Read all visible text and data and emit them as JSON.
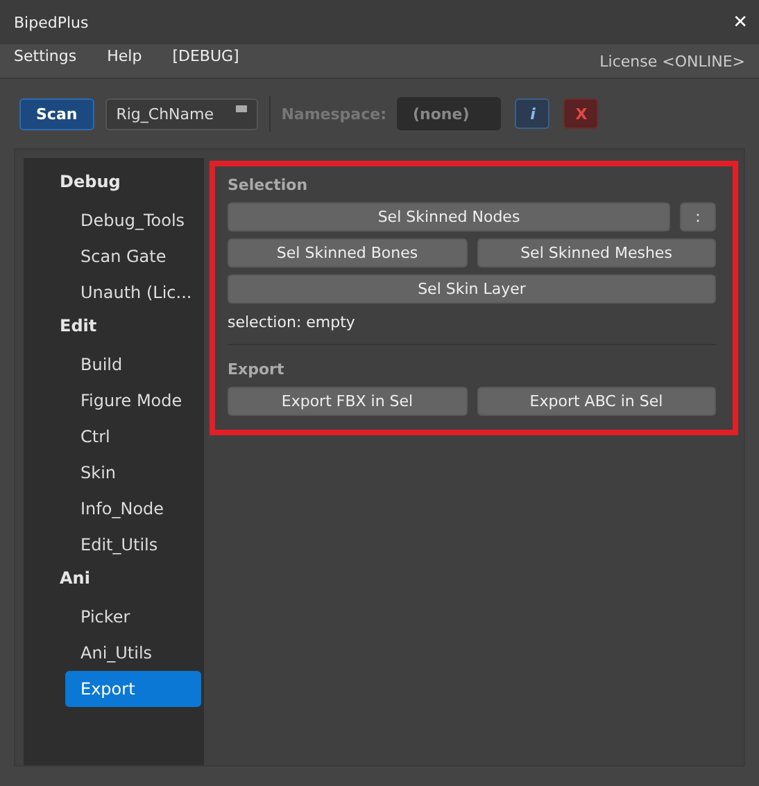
{
  "window": {
    "title": "BipedPlus",
    "close": "✕"
  },
  "menu": [
    "Settings",
    "Help",
    "[DEBUG]"
  ],
  "license": "License <ONLINE>",
  "toolbar": {
    "scan": "Scan",
    "rig_name": "Rig_ChName",
    "namespace_label": "Namespace:",
    "namespace_value": "(none)",
    "info": "i",
    "clear": "X"
  },
  "sidebar": {
    "groups": [
      {
        "label": "Debug",
        "children": [
          {
            "label": "Debug_Tools",
            "selected": false
          },
          {
            "label": "Scan Gate",
            "selected": false
          },
          {
            "label": "Unauth (Lic...",
            "selected": false
          }
        ]
      },
      {
        "label": "Edit",
        "children": [
          {
            "label": "Build",
            "selected": false
          },
          {
            "label": "Figure Mode",
            "selected": false
          },
          {
            "label": "Ctrl",
            "selected": false
          },
          {
            "label": "Skin",
            "selected": false
          },
          {
            "label": "Info_Node",
            "selected": false
          },
          {
            "label": "Edit_Utils",
            "selected": false
          }
        ]
      },
      {
        "label": "Ani",
        "children": [
          {
            "label": "Picker",
            "selected": false
          },
          {
            "label": "Ani_Utils",
            "selected": false
          },
          {
            "label": "Export",
            "selected": true
          }
        ]
      }
    ]
  },
  "panel": {
    "highlighted": true,
    "selection": {
      "title": "Selection",
      "rows": [
        [
          "Sel Skinned Nodes",
          ":"
        ],
        [
          "Sel Skinned Bones",
          "Sel Skinned Meshes"
        ],
        [
          "Sel Skin Layer"
        ]
      ],
      "status": "selection: empty"
    },
    "export": {
      "title": "Export",
      "rows": [
        [
          "Export FBX in Sel",
          "Export ABC in Sel"
        ]
      ]
    }
  }
}
